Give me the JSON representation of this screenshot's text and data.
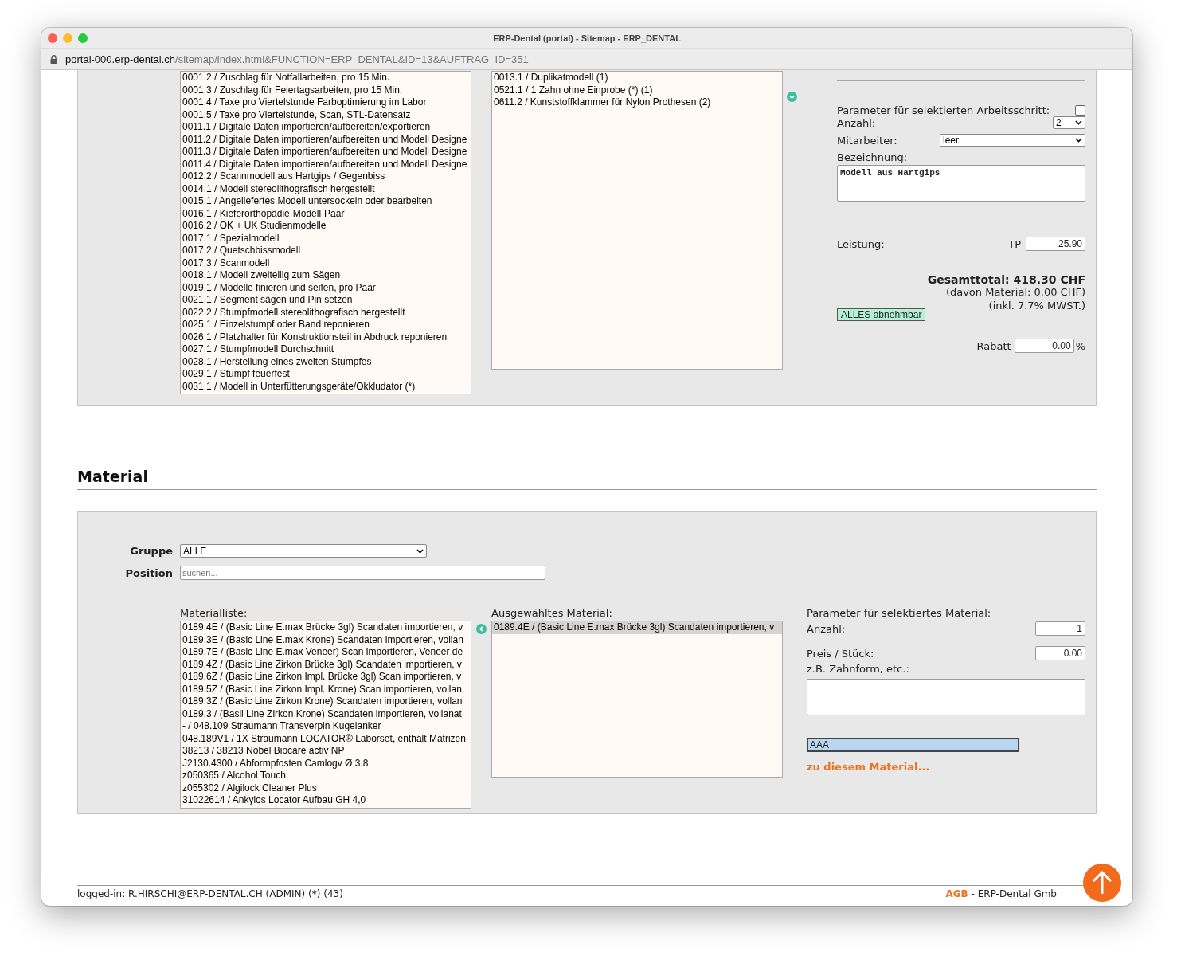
{
  "window": {
    "title": "ERP-Dental (portal) - Sitemap - ERP_DENTAL",
    "url_host": "portal-000.erp-dental.ch",
    "url_path": "/sitemap/index.html&FUNCTION=ERP_DENTAL&ID=13&AUFTRAG_ID=351"
  },
  "work_steps": {
    "list": [
      "0001.2 / Zuschlag für Notfallarbeiten, pro 15 Min.",
      "0001.3 / Zuschlag für Feiertagsarbeiten, pro 15 Min.",
      "0001.4 / Taxe pro Viertelstunde Farboptimierung im Labor",
      "0001.5 / Taxe pro Viertelstunde, Scan, STL-Datensatz",
      "0011.1 / Digitale Daten importieren/aufbereiten/exportieren",
      "0011.2 / Digitale Daten importieren/aufbereiten und Modell Designe",
      "0011.3 / Digitale Daten importieren/aufbereiten und Modell Designe",
      "0011.4 / Digitale Daten importieren/aufbereiten und Modell Designe",
      "0012.2 / Scannmodell aus Hartgips / Gegenbiss",
      "0014.1 / Modell stereolithografisch hergestellt",
      "0015.1 / Angeliefertes Modell untersockeln oder bearbeiten",
      "0016.1 / Kieferorthopädie-Modell-Paar",
      "0016.2 / OK + UK Studienmodelle",
      "0017.1 / Spezialmodell",
      "0017.2 / Quetschbissmodell",
      "0017.3 / Scanmodell",
      "0018.1 / Modell zweiteilig zum Sägen",
      "0019.1 / Modelle finieren und seifen, pro Paar",
      "0021.1 / Segment sägen und Pin setzen",
      "0022.2 / Stumpfmodell stereolithografisch hergestellt",
      "0025.1 / Einzelstumpf oder Band reponieren",
      "0026.1 / Platzhalter für Konstruktionsteil in Abdruck reponieren",
      "0027.1 / Stumpfmodell Durchschnitt",
      "0028.1 / Herstellung eines zweiten Stumpfes",
      "0029.1 / Stumpf feuerfest",
      "0031.1 / Modell in Unterfütterungsgeräte/Okkludator (*)"
    ],
    "chosen": [
      "0013.1 / Duplikatmodell (1)",
      "0521.1 / 1 Zahn ohne Einprobe (*) (1)",
      "0611.2 / Kunststoffklammer für Nylon Prothesen (2)"
    ]
  },
  "step_params": {
    "title": "Parameter für selektierten Arbeitsschritt:",
    "checked": false,
    "anzahl_label": "Anzahl:",
    "anzahl": "2",
    "mitarbeiter_label": "Mitarbeiter:",
    "mitarbeiter": "leer",
    "bezeichnung_label": "Bezeichnung:",
    "bezeichnung": "Modell aus Hartgips",
    "leistung_label": "Leistung:",
    "tp_label": "TP",
    "tp": "25.90",
    "total": "Gesamttotal: 418.30 CHF",
    "material_note": "(davon Material: 0.00 CHF)",
    "vat_note": "(inkl. 7.7% MWST.)",
    "alles_button": "ALLES abnehmbar",
    "rabatt_label": "Rabatt",
    "rabatt": "0.00",
    "percent": "%"
  },
  "material": {
    "heading": "Material",
    "gruppe_label": "Gruppe",
    "gruppe": "ALLE",
    "position_label": "Position",
    "position_placeholder": "suchen...",
    "list_label": "Materialliste:",
    "list": [
      "0189.4E / (Basic Line E.max Brücke 3gl) Scandaten importieren, v",
      "0189.3E / (Basic Line E.max Krone) Scandaten importieren, vollan",
      "0189.7E / (Basic Line E.max Veneer) Scan importieren, Veneer de",
      "0189.4Z / (Basic Line Zirkon Brücke 3gl) Scandaten importieren, v",
      "0189.6Z / (Basic Line Zirkon Impl. Brücke 3gl) Scan importieren, v",
      "0189.5Z / (Basic Line Zirkon Impl. Krone) Scan importieren, vollan",
      "0189.3Z / (Basic Line Zirkon Krone) Scandaten importieren, vollan",
      "0189.3 / (Basil Line Zirkon Krone) Scandaten importieren, vollanat",
      "- / 048.109 Straumann Transverpin Kugelanker",
      "048.189V1 / 1X Straumann LOCATOR® Laborset, enthält Matrizen",
      "38213 / 38213 Nobel Biocare activ NP",
      "J2130.4300 / Abformpfosten Camlogv Ø 3.8",
      "z050365 / Alcohol Touch",
      "z055302 / Algilock Cleaner Plus",
      "31022614 / Ankylos Locator Aufbau GH 4,0"
    ],
    "selected_label": "Ausgewähltes Material:",
    "selected_list": [
      {
        "text": "0189.4E / (Basic Line E.max Brücke 3gl) Scandaten importieren, v",
        "selected": true
      }
    ],
    "params_title": "Parameter für selektiertes Material:",
    "anzahl_label": "Anzahl:",
    "anzahl": "1",
    "preis_label": "Preis / Stück:",
    "preis": "0.00",
    "hint_label": "z.B. Zahnform, etc.:",
    "code": "AAA",
    "link": "zu diesem Material..."
  },
  "footer": {
    "logged_in": "logged-in: R.HIRSCHI@ERP-DENTAL.CH (ADMIN) (*) (43)",
    "agb": "AGB",
    "company": " - ERP-Dental Gmb"
  }
}
